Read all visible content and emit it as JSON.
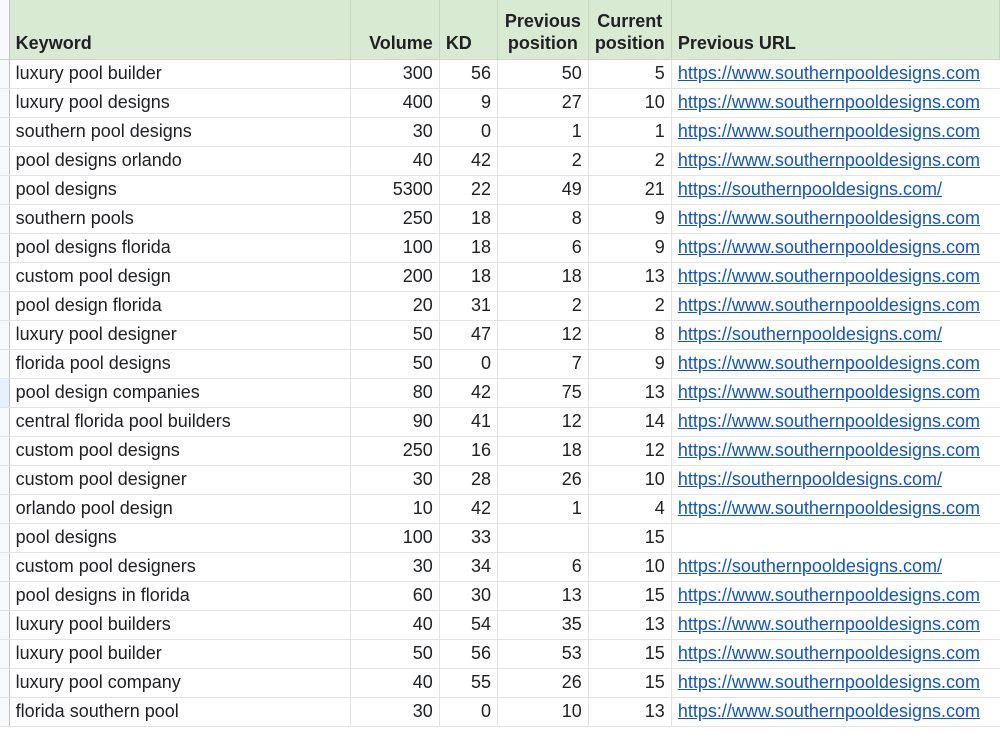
{
  "header": {
    "keyword": "Keyword",
    "volume": "Volume",
    "kd": "KD",
    "previous_position_line1": "Previous",
    "previous_position_line2": "position",
    "current_position_line1": "Current",
    "current_position_line2": "position",
    "previous_url": "Previous URL"
  },
  "rows": [
    {
      "keyword": "luxury pool builder",
      "volume": "300",
      "kd": "56",
      "prev": "50",
      "cur": "5",
      "url": "https://www.southernpooldesigns.com"
    },
    {
      "keyword": "luxury pool designs",
      "volume": "400",
      "kd": "9",
      "prev": "27",
      "cur": "10",
      "url": "https://www.southernpooldesigns.com"
    },
    {
      "keyword": "southern pool designs",
      "volume": "30",
      "kd": "0",
      "prev": "1",
      "cur": "1",
      "url": "https://www.southernpooldesigns.com"
    },
    {
      "keyword": "pool designs orlando",
      "volume": "40",
      "kd": "42",
      "prev": "2",
      "cur": "2",
      "url": "https://www.southernpooldesigns.com"
    },
    {
      "keyword": "pool designs",
      "volume": "5300",
      "kd": "22",
      "prev": "49",
      "cur": "21",
      "url": "https://southernpooldesigns.com/"
    },
    {
      "keyword": "southern pools",
      "volume": "250",
      "kd": "18",
      "prev": "8",
      "cur": "9",
      "url": "https://www.southernpooldesigns.com"
    },
    {
      "keyword": "pool designs florida",
      "volume": "100",
      "kd": "18",
      "prev": "6",
      "cur": "9",
      "url": "https://www.southernpooldesigns.com"
    },
    {
      "keyword": "custom pool design",
      "volume": "200",
      "kd": "18",
      "prev": "18",
      "cur": "13",
      "url": "https://www.southernpooldesigns.com"
    },
    {
      "keyword": "pool design florida",
      "volume": "20",
      "kd": "31",
      "prev": "2",
      "cur": "2",
      "url": "https://www.southernpooldesigns.com"
    },
    {
      "keyword": "luxury pool designer",
      "volume": "50",
      "kd": "47",
      "prev": "12",
      "cur": "8",
      "url": "https://southernpooldesigns.com/"
    },
    {
      "keyword": "florida pool designs",
      "volume": "50",
      "kd": "0",
      "prev": "7",
      "cur": "9",
      "url": "https://www.southernpooldesigns.com"
    },
    {
      "keyword": "pool design companies",
      "volume": "80",
      "kd": "42",
      "prev": "75",
      "cur": "13",
      "url": "https://www.southernpooldesigns.com"
    },
    {
      "keyword": "central florida pool builders",
      "volume": "90",
      "kd": "41",
      "prev": "12",
      "cur": "14",
      "url": "https://www.southernpooldesigns.com"
    },
    {
      "keyword": "custom pool designs",
      "volume": "250",
      "kd": "16",
      "prev": "18",
      "cur": "12",
      "url": "https://www.southernpooldesigns.com"
    },
    {
      "keyword": "custom pool designer",
      "volume": "30",
      "kd": "28",
      "prev": "26",
      "cur": "10",
      "url": "https://southernpooldesigns.com/"
    },
    {
      "keyword": "orlando pool design",
      "volume": "10",
      "kd": "42",
      "prev": "1",
      "cur": "4",
      "url": "https://www.southernpooldesigns.com"
    },
    {
      "keyword": "pool designs",
      "volume": "100",
      "kd": "33",
      "prev": "",
      "cur": "15",
      "url": ""
    },
    {
      "keyword": "custom pool designers",
      "volume": "30",
      "kd": "34",
      "prev": "6",
      "cur": "10",
      "url": "https://southernpooldesigns.com/"
    },
    {
      "keyword": "pool designs in florida",
      "volume": "60",
      "kd": "30",
      "prev": "13",
      "cur": "15",
      "url": "https://www.southernpooldesigns.com"
    },
    {
      "keyword": "luxury pool builders",
      "volume": "40",
      "kd": "54",
      "prev": "35",
      "cur": "13",
      "url": "https://www.southernpooldesigns.com"
    },
    {
      "keyword": "luxury pool builder",
      "volume": "50",
      "kd": "56",
      "prev": "53",
      "cur": "15",
      "url": "https://www.southernpooldesigns.com"
    },
    {
      "keyword": "luxury pool company",
      "volume": "40",
      "kd": "55",
      "prev": "26",
      "cur": "15",
      "url": "https://www.southernpooldesigns.com"
    },
    {
      "keyword": "florida southern pool",
      "volume": "30",
      "kd": "0",
      "prev": "10",
      "cur": "13",
      "url": "https://www.southernpooldesigns.com"
    }
  ],
  "colors": {
    "header_bg": "#d9ead3",
    "link": "#1155cc",
    "grid": "#e2e3e3",
    "selected_row_marker": "#e8f0fe"
  }
}
